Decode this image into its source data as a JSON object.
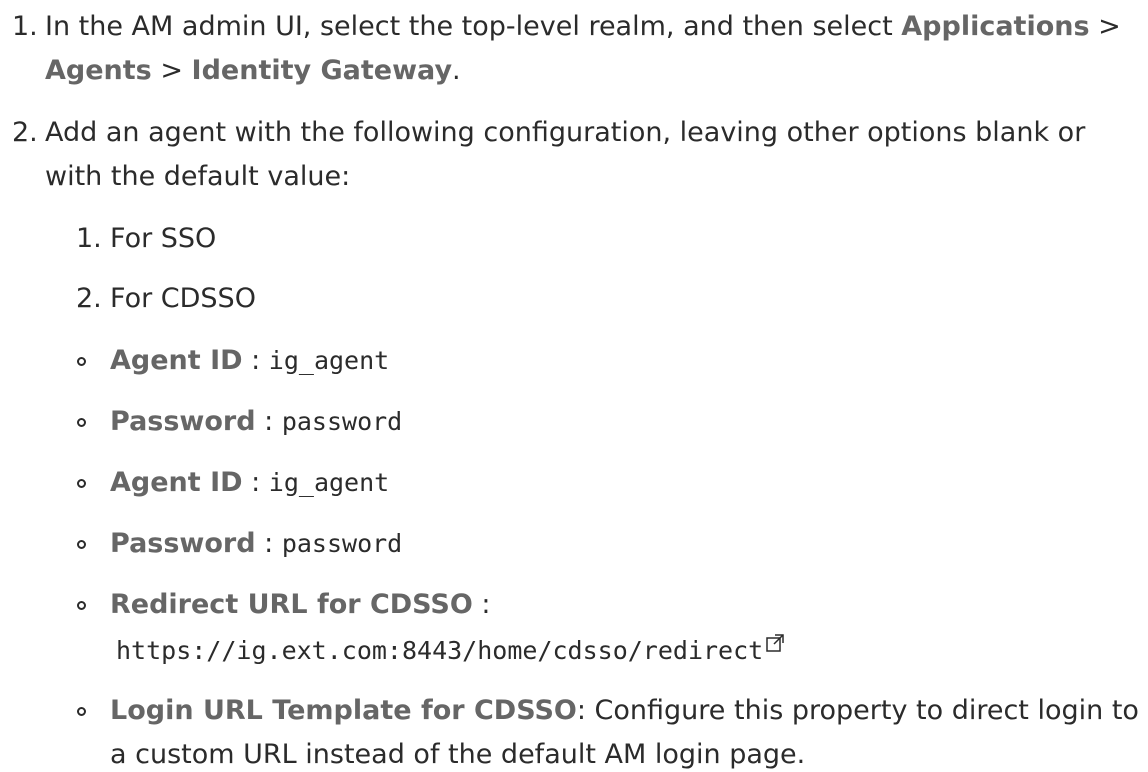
{
  "step1": {
    "number": "1.",
    "text_before": "In the AM admin UI, select the top-level realm, and then select ",
    "menu_applications": "Applications",
    "separator_1": " >",
    "menu_agents": "Agents",
    "separator_2": " > ",
    "menu_identity_gateway": "Identity Gateway",
    "period": "."
  },
  "step2": {
    "number": "2.",
    "text_line1": "Add an agent with the following configuration, leaving other options blank or",
    "text_line2": "with the default value:",
    "substeps": [
      {
        "number": "1.",
        "label": "For SSO"
      },
      {
        "number": "2.",
        "label": "For CDSSO"
      }
    ],
    "fields": [
      {
        "label": "Agent ID",
        "sep": " : ",
        "value": "ig_agent"
      },
      {
        "label": "Password",
        "sep": " : ",
        "value": "password"
      },
      {
        "label": "Agent ID",
        "sep": " : ",
        "value": "ig_agent"
      },
      {
        "label": "Password",
        "sep": " : ",
        "value": "password"
      },
      {
        "label": "Redirect URL for CDSSO",
        "sep": " :",
        "value": "https://ig.ext.com:8443/home/cdsso/redirect"
      },
      {
        "label": "Login URL Template for CDSSO",
        "sep": ": ",
        "value_line1": "Configure this property to direct login to",
        "value_line2": "a custom URL instead of the default AM login page."
      }
    ]
  }
}
